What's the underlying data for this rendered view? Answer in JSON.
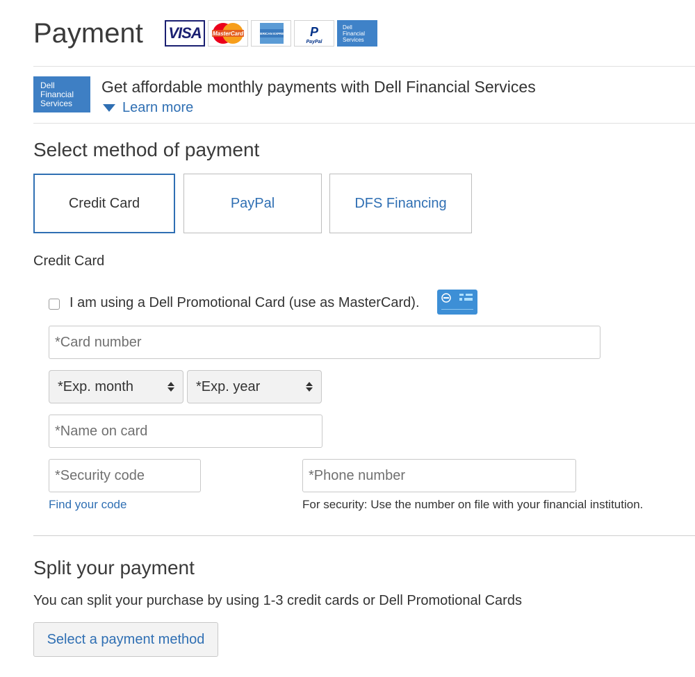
{
  "header": {
    "title": "Payment",
    "card_logos": [
      {
        "name": "visa-logo",
        "text": "VISA"
      },
      {
        "name": "mastercard-logo",
        "text": "MasterCard"
      },
      {
        "name": "amex-logo",
        "text": "AMERICAN EXPRESS"
      },
      {
        "name": "paypal-logo",
        "text": "PayPal"
      },
      {
        "name": "dell-financial-logo",
        "text": "Dell Financial Services"
      }
    ]
  },
  "promo": {
    "logo_text": "Dell Financial Services",
    "text": "Get affordable monthly payments with Dell Financial Services",
    "learn_more": "Learn more"
  },
  "method": {
    "heading": "Select method of payment",
    "options": [
      {
        "label": "Credit Card",
        "selected": true
      },
      {
        "label": "PayPal",
        "selected": false
      },
      {
        "label": "DFS Financing",
        "selected": false
      }
    ]
  },
  "credit_card": {
    "heading": "Credit Card",
    "promo_checkbox_label": "I am using a Dell Promotional Card (use as MasterCard).",
    "card_number_placeholder": "*Card number",
    "exp_month": "*Exp. month",
    "exp_year": "*Exp. year",
    "name_placeholder": "*Name on card",
    "security_placeholder": "*Security code",
    "find_code": "Find your code",
    "phone_placeholder": "*Phone number",
    "phone_note": "For security: Use the number on file with your financial institution."
  },
  "split": {
    "heading": "Split your payment",
    "description": "You can split your purchase by using 1-3 credit cards or Dell Promotional Cards",
    "button": "Select a payment method"
  },
  "colors": {
    "accent": "#2f6fb3",
    "dfs_blue": "#3e7fc4"
  }
}
